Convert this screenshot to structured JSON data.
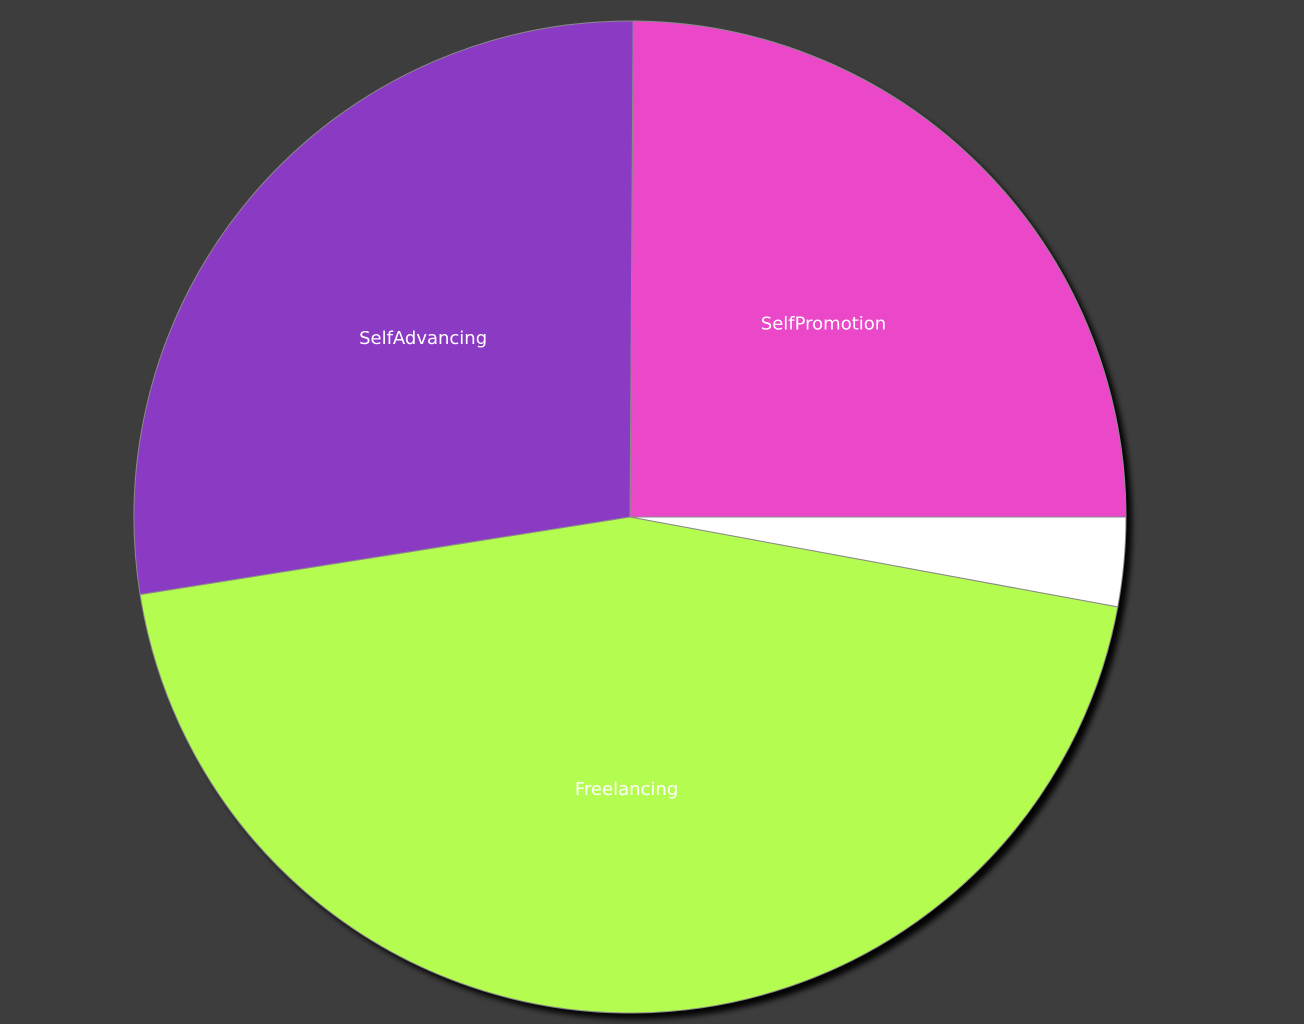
{
  "chart_data": {
    "type": "pie",
    "title": "",
    "background_color": "#3d3d3d",
    "slices": [
      {
        "label": "SelfPromotion",
        "value": 24.9,
        "color": "#ea48c8",
        "show_label": true
      },
      {
        "label": "SelfAdvancing",
        "value": 27.6,
        "color": "#8b3ac4",
        "show_label": true
      },
      {
        "label": "Freelancing",
        "value": 44.6,
        "color": "#b4fc50",
        "show_label": true
      },
      {
        "label": "",
        "value": 2.9,
        "color": "#ffffff",
        "show_label": false
      }
    ],
    "start_angle_deg": 0,
    "direction": "counterclockwise",
    "legend": "none",
    "grid": false
  }
}
